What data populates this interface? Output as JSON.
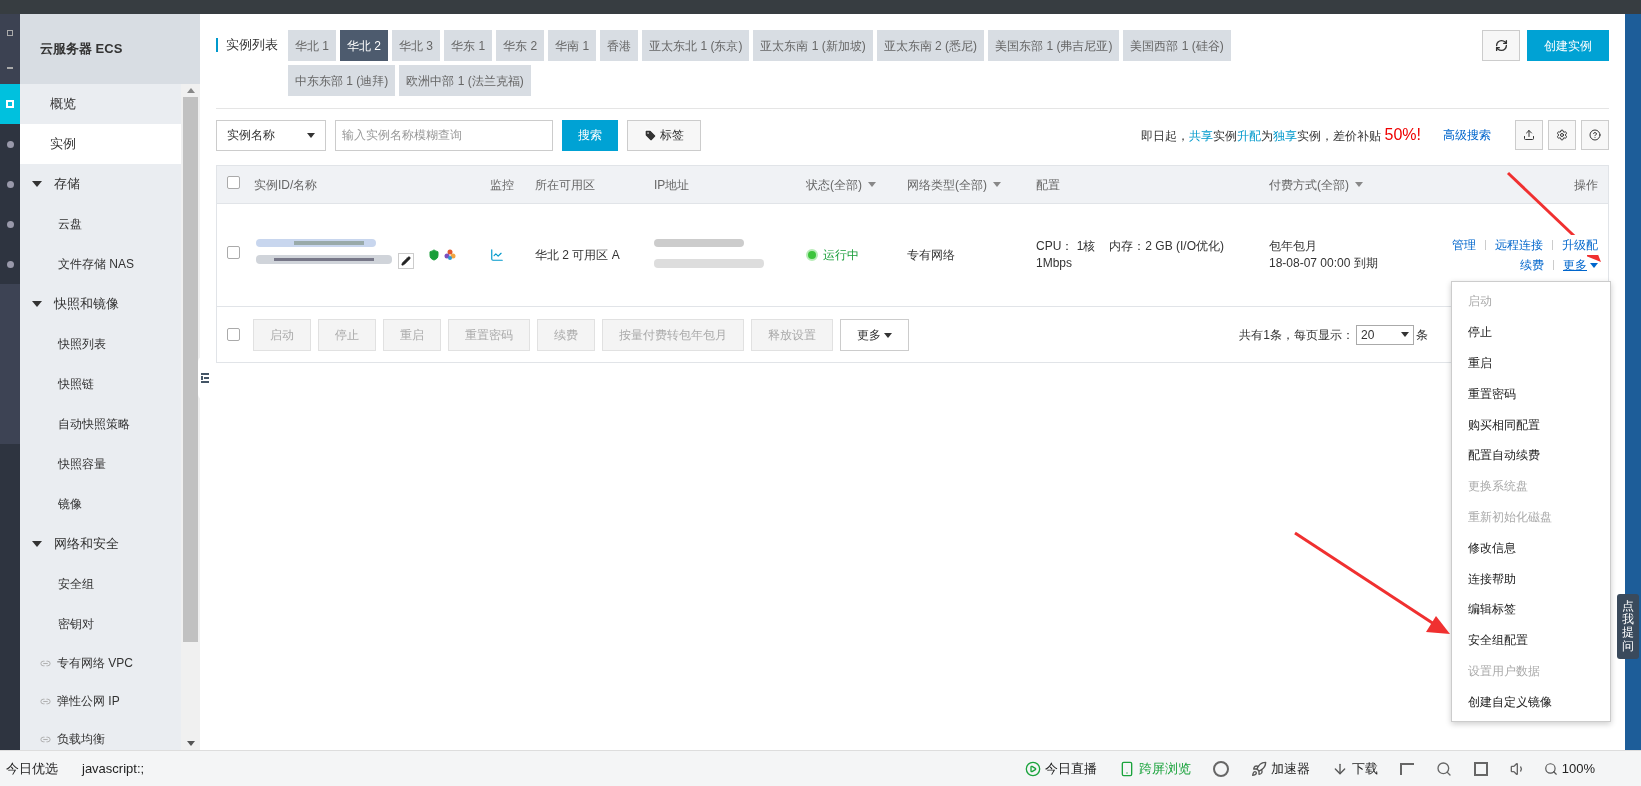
{
  "sidebar": {
    "title": "云服务器 ECS",
    "items": [
      {
        "label": "概览",
        "kind": "link",
        "selected": false
      },
      {
        "label": "实例",
        "kind": "link",
        "selected": true
      },
      {
        "label": "存储",
        "kind": "group",
        "expanded": true,
        "children": [
          {
            "label": "云盘",
            "selected": false
          },
          {
            "label": "文件存储 NAS",
            "selected": false
          }
        ]
      },
      {
        "label": "快照和镜像",
        "kind": "group",
        "expanded": true,
        "children": [
          {
            "label": "快照列表",
            "selected": false
          },
          {
            "label": "快照链",
            "selected": false
          },
          {
            "label": "自动快照策略",
            "selected": false
          },
          {
            "label": "快照容量",
            "selected": false
          },
          {
            "label": "镜像",
            "selected": false
          }
        ]
      },
      {
        "label": "网络和安全",
        "kind": "group",
        "expanded": true,
        "children": [
          {
            "label": "安全组",
            "selected": false
          },
          {
            "label": "密钥对",
            "selected": false
          }
        ]
      },
      {
        "label": "专有网络 VPC",
        "kind": "external",
        "selected": false
      },
      {
        "label": "弹性公网 IP",
        "kind": "external",
        "selected": false
      },
      {
        "label": "负载均衡",
        "kind": "external",
        "selected": false
      }
    ]
  },
  "region_tabs": {
    "label": "实例列表",
    "tabs": [
      {
        "label": "华北 1",
        "selected": false
      },
      {
        "label": "华北 2",
        "selected": true
      },
      {
        "label": "华北 3",
        "selected": false
      },
      {
        "label": "华东 1",
        "selected": false
      },
      {
        "label": "华东 2",
        "selected": false
      },
      {
        "label": "华南 1",
        "selected": false
      },
      {
        "label": "香港",
        "selected": false
      },
      {
        "label": "亚太东北 1 (东京)",
        "selected": false
      },
      {
        "label": "亚太东南 1 (新加坡)",
        "selected": false
      },
      {
        "label": "亚太东南 2 (悉尼)",
        "selected": false
      },
      {
        "label": "美国东部 1 (弗吉尼亚)",
        "selected": false
      },
      {
        "label": "美国西部 1 (硅谷)",
        "selected": false
      },
      {
        "label": "中东东部 1 (迪拜)",
        "selected": false
      },
      {
        "label": "欧洲中部 1 (法兰克福)",
        "selected": false
      }
    ]
  },
  "create_button": "创建实例",
  "search": {
    "field_select": "实例名称",
    "placeholder": "输入实例名称模糊查询",
    "search_button": "搜索",
    "tag_button": "标签"
  },
  "promo": [
    {
      "text": "即日起，",
      "kind": "plain"
    },
    {
      "text": "共享",
      "kind": "link"
    },
    {
      "text": "实例",
      "kind": "plain"
    },
    {
      "text": "升配",
      "kind": "link"
    },
    {
      "text": "为",
      "kind": "plain"
    },
    {
      "text": "独享",
      "kind": "link"
    },
    {
      "text": "实例，差价补贴 ",
      "kind": "plain"
    },
    {
      "text": "50%!",
      "kind": "highlight"
    }
  ],
  "advanced_search": "高级搜索",
  "table": {
    "all_checked": false,
    "columns": [
      {
        "label": "实例ID/名称",
        "filter": false
      },
      {
        "label": "监控",
        "filter": false
      },
      {
        "label": "所在可用区",
        "filter": false
      },
      {
        "label": "IP地址",
        "filter": false
      },
      {
        "label": "状态(全部)",
        "filter": true
      },
      {
        "label": "网络类型(全部)",
        "filter": true
      },
      {
        "label": "配置",
        "filter": false
      },
      {
        "label": "付费方式(全部)",
        "filter": true
      },
      {
        "label": "操作",
        "filter": false
      }
    ],
    "rows": [
      {
        "checked": false,
        "zone": "华北 2 可用区 A",
        "status": "运行中",
        "running": true,
        "network": "专有网络",
        "config": [
          "CPU： 1核",
          "内存：2 GB (I/O优化)",
          "1Mbps"
        ],
        "billing": [
          "包年包月",
          "18-08-07 00:00 到期"
        ],
        "actions": [
          "管理",
          "远程连接",
          "升级配",
          "续费"
        ],
        "more": "更多"
      }
    ]
  },
  "bulk_actions": {
    "checked": false,
    "buttons": [
      {
        "label": "启动",
        "disabled": true
      },
      {
        "label": "停止",
        "disabled": true
      },
      {
        "label": "重启",
        "disabled": true
      },
      {
        "label": "重置密码",
        "disabled": true
      },
      {
        "label": "续费",
        "disabled": true
      },
      {
        "label": "按量付费转包年包月",
        "disabled": true
      },
      {
        "label": "释放设置",
        "disabled": true
      },
      {
        "label": "更多",
        "disabled": false
      }
    ]
  },
  "pagination": {
    "total": "共有1条，每页显示：",
    "page_size": "20",
    "unit": "条"
  },
  "more_menu": [
    {
      "label": "启动",
      "disabled": true
    },
    {
      "label": "停止",
      "disabled": false
    },
    {
      "label": "重启",
      "disabled": false
    },
    {
      "label": "重置密码",
      "disabled": false
    },
    {
      "label": "购买相同配置",
      "disabled": false
    },
    {
      "label": "配置自动续费",
      "disabled": false
    },
    {
      "label": "更换系统盘",
      "disabled": true
    },
    {
      "label": "重新初始化磁盘",
      "disabled": true
    },
    {
      "label": "修改信息",
      "disabled": false
    },
    {
      "label": "连接帮助",
      "disabled": false
    },
    {
      "label": "编辑标签",
      "disabled": false
    },
    {
      "label": "安全组配置",
      "disabled": false
    },
    {
      "label": "设置用户数据",
      "disabled": true
    },
    {
      "label": "创建自定义镜像",
      "disabled": false
    }
  ],
  "feedback_tab": "点我提问",
  "status_bar": {
    "left": [
      "今日优选",
      "javascript:;"
    ],
    "right": [
      {
        "label": "今日直播",
        "kind": "live"
      },
      {
        "label": "跨屏浏览",
        "kind": "phone"
      },
      {
        "kind": "none"
      },
      {
        "label": "加速器",
        "kind": "rocket"
      },
      {
        "label": "下载",
        "kind": "download"
      }
    ],
    "zoom": "100%"
  }
}
